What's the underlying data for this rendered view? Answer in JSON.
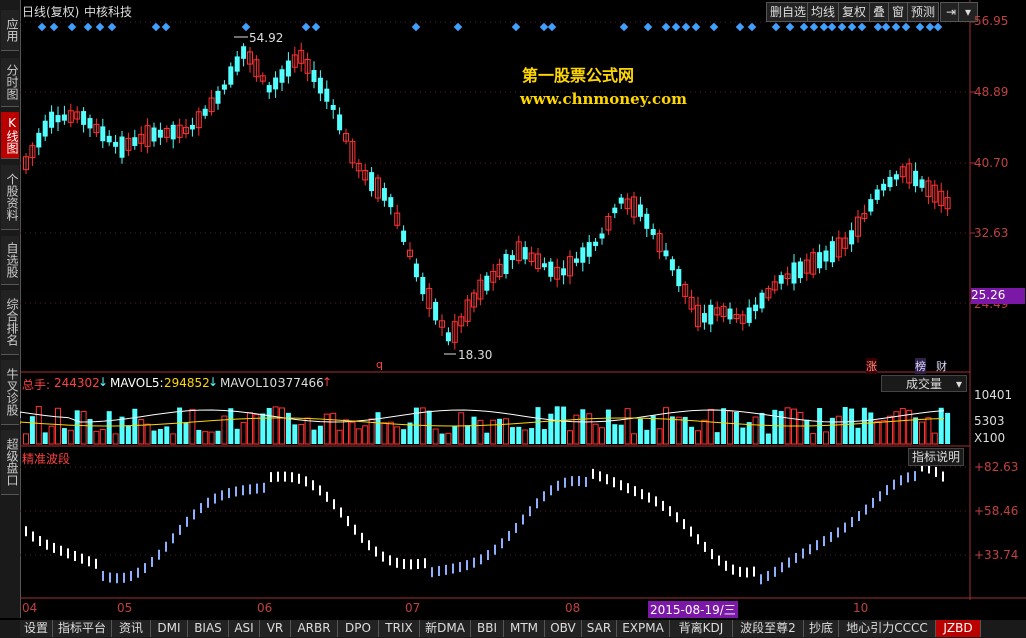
{
  "header": {
    "title": "日线(复权)",
    "stock_name": "中核科技",
    "buttons": [
      "删自选",
      "均线",
      "复权",
      "叠",
      "窗",
      "预测"
    ]
  },
  "sidebar": {
    "tabs": [
      "应用",
      "分时图",
      "K线图",
      "个股资料",
      "自选股",
      "综合排名",
      "牛叉诊股",
      "超级盘口"
    ],
    "active": "K线图"
  },
  "watermark": {
    "line1": "第一股票公式网",
    "line2": "www.chnmoney.com"
  },
  "price_axis": {
    "labels": [
      "56.95",
      "48.89",
      "40.70",
      "32.63",
      "24.49"
    ],
    "current": "25.26"
  },
  "annotations": {
    "high": "54.92",
    "low": "18.30",
    "marker_q": "q",
    "marker_zhang": "涨",
    "marker_bang": "榜",
    "marker_cai": "财"
  },
  "volume": {
    "total_label": "总手:",
    "total_value": "244302",
    "mavol5_label": "MAVOL5:",
    "mavol5_value": "294852",
    "mavol10_label": "MAVOL10:",
    "mavol10_value": "377466",
    "selector": "成交量",
    "axis": [
      "10401",
      "5303",
      "X100"
    ]
  },
  "indicator": {
    "name": "精准波段",
    "help": "指标说明",
    "axis": [
      "+82.63",
      "+58.46",
      "+33.74"
    ]
  },
  "time_axis": {
    "labels": [
      "04",
      "05",
      "06",
      "07",
      "08",
      "10"
    ],
    "cursor_date": "2015-08-19/三"
  },
  "bottom_tabs": [
    "设置",
    "指标平台",
    "资讯",
    "DMI",
    "BIAS",
    "ASI",
    "VR",
    "ARBR",
    "DPO",
    "TRIX",
    "新DMA",
    "BBI",
    "MTM",
    "OBV",
    "SAR",
    "EXPMA",
    "背离KDJ",
    "波段至尊2",
    "抄底",
    "地心引力CCCC",
    "JZBD"
  ],
  "bottom_active": "JZBD",
  "colors": {
    "up": "#ff3232",
    "down": "#54ffff",
    "diamond": "#3fa0ff",
    "axis": "#c04040",
    "watermark": "#ffd700"
  }
}
